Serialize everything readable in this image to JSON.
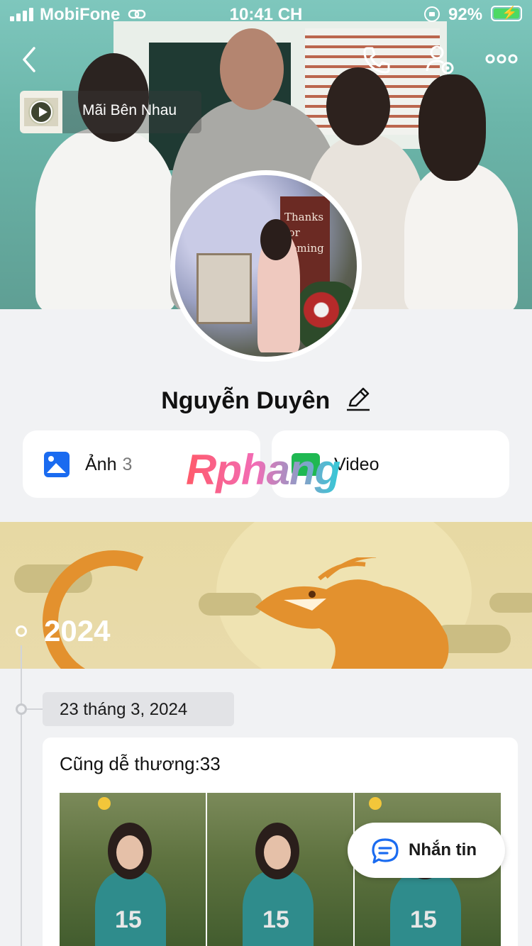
{
  "status_bar": {
    "carrier": "MobiFone",
    "time": "10:41 CH",
    "battery": "92%"
  },
  "music": {
    "title": "Mãi Bên Nhau"
  },
  "profile": {
    "name": "Nguyễn Duyên"
  },
  "tabs": {
    "photos_label": "Ảnh",
    "photos_count": "3",
    "video_label": "Video"
  },
  "watermark": "Rphang",
  "avatar": {
    "sign_text": "Thanks\nfor\ncoming"
  },
  "timeline": {
    "year": "2024",
    "date": "23 tháng 3, 2024",
    "post_caption": "Cũng dễ thương:33"
  },
  "chat": {
    "label": "Nhắn tin"
  },
  "colors": {
    "photo_icon": "#1a6bf0",
    "video_icon": "#1fb852",
    "battery_fill": "#4cd964",
    "banner_bg": "#e7d9a3"
  },
  "icons": [
    "back-icon",
    "phone-icon",
    "user-settings-icon",
    "more-icon",
    "play-icon",
    "pencil-icon",
    "image-icon",
    "video-icon",
    "chat-icon"
  ]
}
